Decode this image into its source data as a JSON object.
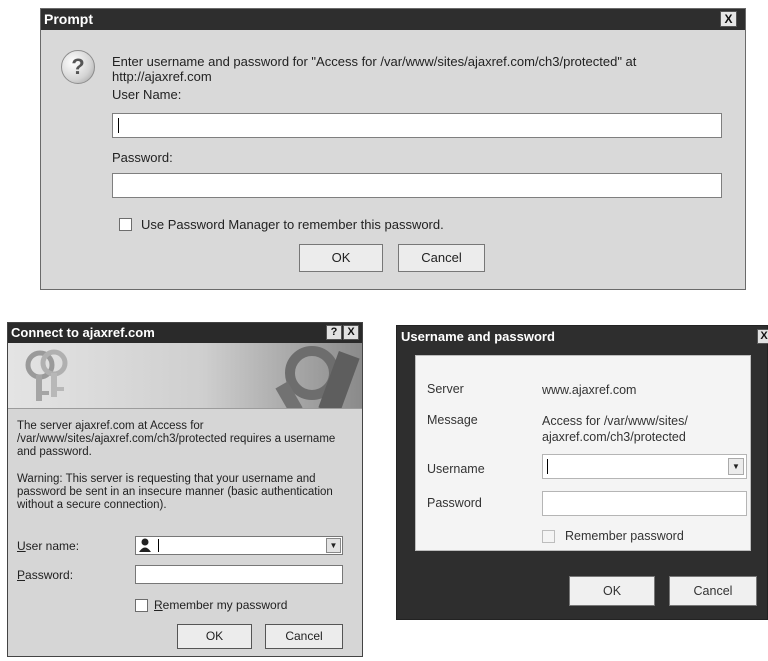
{
  "prompt_dialog": {
    "title": "Prompt",
    "close_glyph": "X",
    "message": "Enter username and password for \"Access for /var/www/sites/ajaxref.com/ch3/protected\" at http://ajaxref.com",
    "username_label": "User Name:",
    "username_value": "",
    "password_label": "Password:",
    "password_value": "",
    "remember_label": "Use Password Manager to remember this password.",
    "ok_label": "OK",
    "cancel_label": "Cancel",
    "icon": "question-icon"
  },
  "connect_dialog": {
    "title": "Connect to ajaxref.com",
    "help_glyph": "?",
    "close_glyph": "X",
    "message": "The server ajaxref.com at Access for /var/www/sites/ajaxref.com/ch3/protected requires a username and password.",
    "warning": "Warning: This server is requesting that your username and password be sent in an insecure manner (basic authentication without a secure connection).",
    "username_label_accel": "U",
    "username_label_rest": "ser name:",
    "username_value": "",
    "password_label_accel": "P",
    "password_label_rest": "assword:",
    "password_value": "",
    "remember_label_accel": "R",
    "remember_label_rest": "emember my password",
    "ok_label": "OK",
    "cancel_label": "Cancel",
    "icons": [
      "keys-icon",
      "user-icon",
      "chevron-down-icon"
    ]
  },
  "credentials_dialog": {
    "title": "Username and password",
    "close_glyph": "X",
    "server_label": "Server",
    "server_value": "www.ajaxref.com",
    "message_label": "Message",
    "message_value": "Access for /var/www/sites/ ajaxref.com/ch3/protected",
    "username_label": "Username",
    "username_value": "",
    "password_label": "Password",
    "password_value": "",
    "remember_label": "Remember password",
    "ok_label": "OK",
    "cancel_label": "Cancel"
  }
}
